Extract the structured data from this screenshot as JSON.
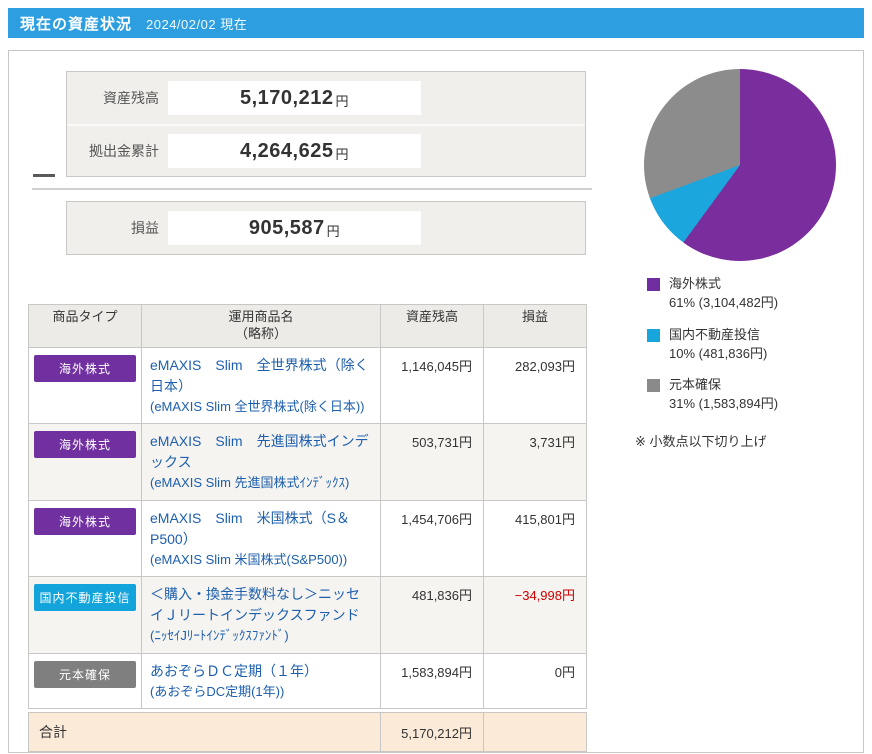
{
  "header": {
    "title": "現在の資産状況",
    "date": "2024/02/02 現在"
  },
  "summary": {
    "balance": {
      "label": "資産残高",
      "value": "5,170,212",
      "unit": "円"
    },
    "contributions": {
      "label": "拠出金累計",
      "value": "4,264,625",
      "unit": "円"
    },
    "profit": {
      "label": "損益",
      "value": "905,587",
      "unit": "円"
    },
    "operator": "−"
  },
  "chart_data": {
    "type": "pie",
    "categories": [
      "海外株式",
      "国内不動産投信",
      "元本確保"
    ],
    "values": [
      3104482,
      481836,
      1583894
    ],
    "percent_labels": [
      61,
      10,
      31
    ],
    "colors": [
      "#7a2e9d",
      "#1ba7de",
      "#8c8c8c"
    ],
    "legend_position": "below",
    "note": "※ 小数点以下切り上げ"
  },
  "pie": {
    "slices": [
      {
        "label": "海外株式",
        "detail": "61% (3,104,482円)",
        "pct": 60.05,
        "color": "#7a2e9d",
        "legend_color": "#6f2da0"
      },
      {
        "label": "国内不動産投信",
        "detail": "10% (481,836円)",
        "pct": 9.32,
        "color": "#1ba7de",
        "legend_color": "#18a5dc"
      },
      {
        "label": "元本確保",
        "detail": "31% (1,583,894円)",
        "pct": 30.63,
        "color": "#8c8c8c",
        "legend_color": "#8a8a8a"
      }
    ],
    "note": "※ 小数点以下切り上げ"
  },
  "table": {
    "headers": {
      "type": "商品タイプ",
      "name": "運用商品名",
      "name_sub": "（略称）",
      "balance": "資産残高",
      "profit": "損益"
    },
    "rows": [
      {
        "type": "海外株式",
        "type_color": "#7030a0",
        "name": "eMAXIS　Slim　全世界株式（除く日本）",
        "abbr": "(eMAXIS Slim 全世界株式(除く日本))",
        "balance": "1,146,045円",
        "profit": "282,093円",
        "profit_color": "#333333"
      },
      {
        "type": "海外株式",
        "type_color": "#7030a0",
        "name": "eMAXIS　Slim　先進国株式インデックス",
        "abbr": "(eMAXIS Slim 先進国株式ｲﾝﾃﾞｯｸｽ)",
        "balance": "503,731円",
        "profit": "3,731円",
        "profit_color": "#333333"
      },
      {
        "type": "海外株式",
        "type_color": "#7030a0",
        "name": "eMAXIS　Slim　米国株式（S＆P500）",
        "abbr": "(eMAXIS Slim 米国株式(S&P500))",
        "balance": "1,454,706円",
        "profit": "415,801円",
        "profit_color": "#333333"
      },
      {
        "type": "国内不動産投信",
        "type_color": "#14a4dc",
        "name": "＜購入・換金手数料なし＞ニッセイＪリートインデックスファンド",
        "abbr": "(ﾆｯｾｲJﾘｰﾄｲﾝﾃﾞｯｸｽﾌｧﾝﾄﾞ)",
        "balance": "481,836円",
        "profit": "−34,998円",
        "profit_color": "#cc0000"
      },
      {
        "type": "元本確保",
        "type_color": "#7f7f7f",
        "name": "あおぞらＤＣ定期（１年）",
        "abbr": "(あおぞらDC定期(1年))",
        "balance": "1,583,894円",
        "profit": "0円",
        "profit_color": "#333333"
      }
    ],
    "total": {
      "label": "合計",
      "balance": "5,170,212円"
    }
  }
}
